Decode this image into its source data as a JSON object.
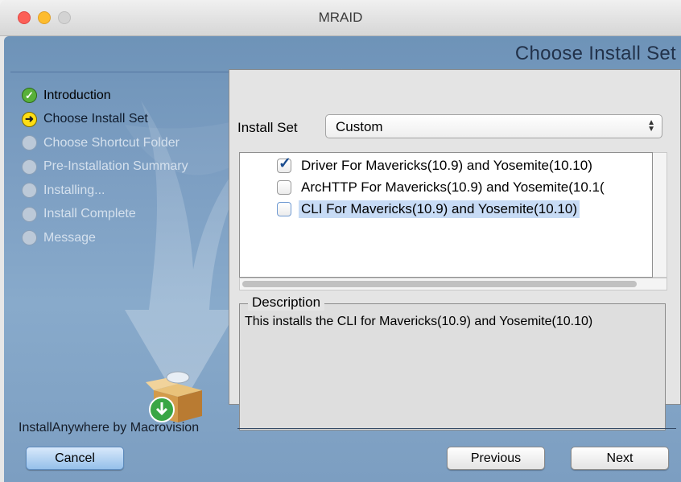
{
  "window": {
    "title": "MRAID"
  },
  "page": {
    "title": "Choose Install Set"
  },
  "steps": [
    {
      "label": "Introduction",
      "status": "done"
    },
    {
      "label": "Choose Install Set",
      "status": "current"
    },
    {
      "label": "Choose Shortcut Folder",
      "status": "pending"
    },
    {
      "label": "Pre-Installation Summary",
      "status": "pending"
    },
    {
      "label": "Installing...",
      "status": "pending"
    },
    {
      "label": "Install Complete",
      "status": "pending"
    },
    {
      "label": "Message",
      "status": "pending"
    }
  ],
  "install_set": {
    "label": "Install Set",
    "selected": "Custom"
  },
  "components": [
    {
      "label": "Driver For Mavericks(10.9) and Yosemite(10.10)",
      "checked": true,
      "selected": false
    },
    {
      "label": "ArcHTTP For Mavericks(10.9) and Yosemite(10.1(",
      "checked": false,
      "selected": false
    },
    {
      "label": "CLI For Mavericks(10.9) and Yosemite(10.10)",
      "checked": false,
      "selected": true
    }
  ],
  "description": {
    "legend": "Description",
    "text": "This installs the CLI for Mavericks(10.9) and Yosemite(10.10)"
  },
  "brand": "InstallAnywhere by Macrovision",
  "buttons": {
    "cancel": "Cancel",
    "previous": "Previous",
    "next": "Next"
  },
  "icons": {
    "done": "check-circle-icon",
    "current": "arrow-circle-icon",
    "pending": "empty-circle-icon",
    "installer": "installer-box-icon"
  },
  "colors": {
    "frame": "#7c9ec2",
    "selection": "#c7dbf5",
    "done": "#58b03a",
    "current": "#ffde14"
  }
}
